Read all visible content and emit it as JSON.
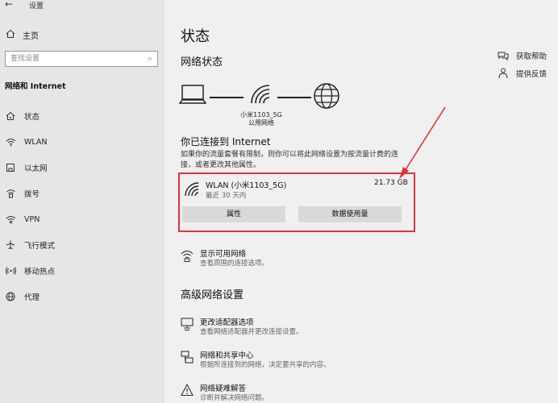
{
  "window": {
    "title": "设置"
  },
  "sidebar": {
    "home_label": "主页",
    "search_placeholder": "查找设置",
    "section_title": "网络和 Internet",
    "items": [
      {
        "label": "状态",
        "icon": "home-network-icon"
      },
      {
        "label": "WLAN",
        "icon": "wifi-icon"
      },
      {
        "label": "以太网",
        "icon": "ethernet-icon"
      },
      {
        "label": "拨号",
        "icon": "dialup-icon"
      },
      {
        "label": "VPN",
        "icon": "vpn-icon"
      },
      {
        "label": "飞行模式",
        "icon": "airplane-icon"
      },
      {
        "label": "移动热点",
        "icon": "hotspot-icon"
      },
      {
        "label": "代理",
        "icon": "globe-icon"
      }
    ]
  },
  "main": {
    "title": "状态",
    "network_status_title": "网络状态",
    "network_name": "小米1103_5G",
    "network_type": "公用网络",
    "connected_title": "你已连接到 Internet",
    "connected_desc": "如果你的流量套餐有限制，则你可以将此网络设置为按流量计费的连接，或者更改其他属性。",
    "connection": {
      "name": "WLAN (小米1103_5G)",
      "time": "最近 30 天内",
      "usage": "21.73 GB",
      "properties_button": "属性",
      "data_usage_button": "数据使用量"
    },
    "show_networks": {
      "title": "显示可用网络",
      "desc": "查看周围的连接选项。"
    },
    "advanced_title": "高级网络设置",
    "advanced_items": [
      {
        "title": "更改适配器选项",
        "desc": "查看网络适配器并更改连接设置。"
      },
      {
        "title": "网络和共享中心",
        "desc": "根据所连接到的网络，决定要共享的内容。"
      },
      {
        "title": "网络疑难解答",
        "desc": "诊断并解决网络问题。"
      }
    ]
  },
  "right_links": [
    {
      "label": "获取帮助",
      "icon": "help-chat-icon"
    },
    {
      "label": "提供反馈",
      "icon": "feedback-icon"
    }
  ],
  "colors": {
    "highlight": "#e0333c",
    "accent": "#1a1a1a"
  }
}
